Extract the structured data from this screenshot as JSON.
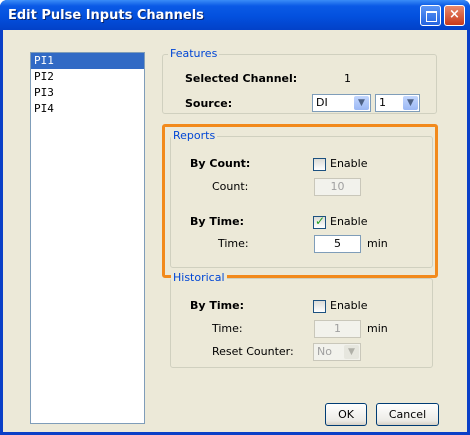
{
  "window": {
    "title": "Edit Pulse Inputs Channels"
  },
  "channels": [
    "PI1",
    "PI2",
    "PI3",
    "PI4"
  ],
  "features": {
    "group_title": "Features",
    "selected_channel_label": "Selected Channel:",
    "selected_channel_value": "1",
    "source_label": "Source:",
    "source_type": "DI",
    "source_number": "1"
  },
  "reports": {
    "group_title": "Reports",
    "by_count_label": "By Count:",
    "by_count_enable": "Enable",
    "count_label": "Count:",
    "count_value": "10",
    "by_time_label": "By Time:",
    "by_time_enable": "Enable",
    "time_label": "Time:",
    "time_value": "5",
    "time_unit": "min"
  },
  "historical": {
    "group_title": "Historical",
    "by_time_label": "By Time:",
    "by_time_enable": "Enable",
    "time_label": "Time:",
    "time_value": "1",
    "time_unit": "min",
    "reset_label": "Reset Counter:",
    "reset_value": "No"
  },
  "buttons": {
    "ok": "OK",
    "cancel": "Cancel"
  },
  "colors": {
    "titlebar": "#0a58e0",
    "selection": "#316ac5",
    "highlight": "#f28a1c",
    "group_title": "#0046d5"
  }
}
